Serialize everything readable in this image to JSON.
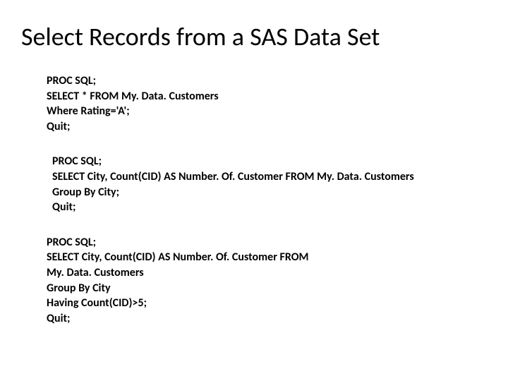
{
  "title": "Select Records from a SAS Data Set",
  "blocks": [
    {
      "lines": [
        "PROC SQL;",
        "SELECT * FROM My. Data. Customers",
        "Where Rating='A';",
        "Quit;"
      ]
    },
    {
      "lines": [
        "PROC SQL;",
        "SELECT City, Count(CID) AS Number. Of. Customer FROM My. Data. Customers",
        "Group By City;",
        "Quit;"
      ]
    },
    {
      "lines": [
        "PROC SQL;",
        "SELECT City, Count(CID) AS Number. Of. Customer FROM",
        "My. Data. Customers",
        "Group By City",
        "Having Count(CID)>5;",
        "Quit;"
      ]
    }
  ]
}
